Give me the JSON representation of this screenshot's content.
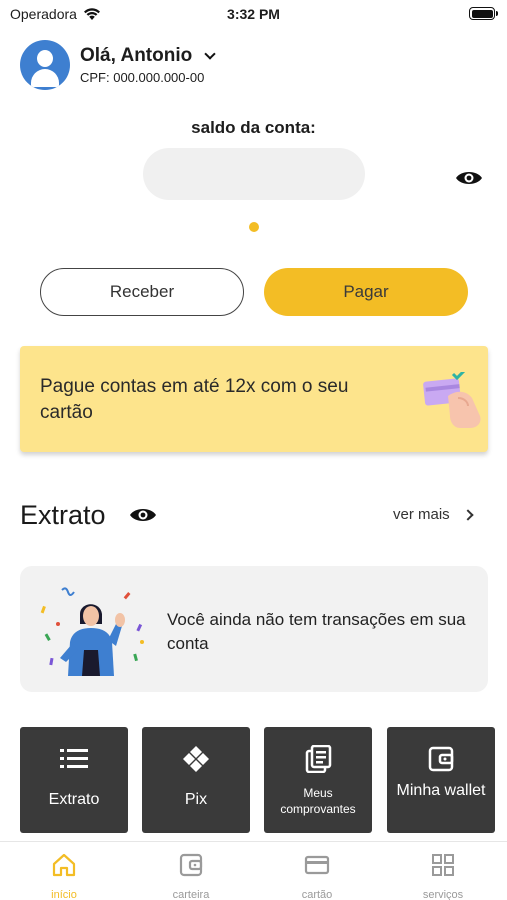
{
  "status_bar": {
    "carrier": "Operadora",
    "time": "3:32 PM"
  },
  "header": {
    "greeting": "Olá, Antonio",
    "cpf": "CPF: 000.000.000-00"
  },
  "balance": {
    "label": "saldo da conta:"
  },
  "actions": {
    "receive_label": "Receber",
    "pay_label": "Pagar"
  },
  "promo": {
    "text": "Pague contas em até 12x com o seu cartão"
  },
  "statement": {
    "title": "Extrato",
    "see_more": "ver mais",
    "empty_text": "Você ainda não tem transações em sua conta"
  },
  "shortcuts": [
    {
      "label": "Extrato",
      "icon": "list-icon"
    },
    {
      "label": "Pix",
      "icon": "pix-icon"
    },
    {
      "label": "Meus comprovantes",
      "icon": "receipts-icon"
    },
    {
      "label": "Minha wallet",
      "icon": "wallet-icon"
    }
  ],
  "nav": [
    {
      "label": "início",
      "icon": "home-icon",
      "active": true
    },
    {
      "label": "carteira",
      "icon": "wallet-icon"
    },
    {
      "label": "cartão",
      "icon": "card-icon"
    },
    {
      "label": "serviços",
      "icon": "grid-icon"
    }
  ],
  "colors": {
    "accent": "#f3bd25",
    "promo_bg": "#fde48c",
    "tile_bg": "#3a3a3a",
    "avatar_bg": "#3e7fd0"
  }
}
